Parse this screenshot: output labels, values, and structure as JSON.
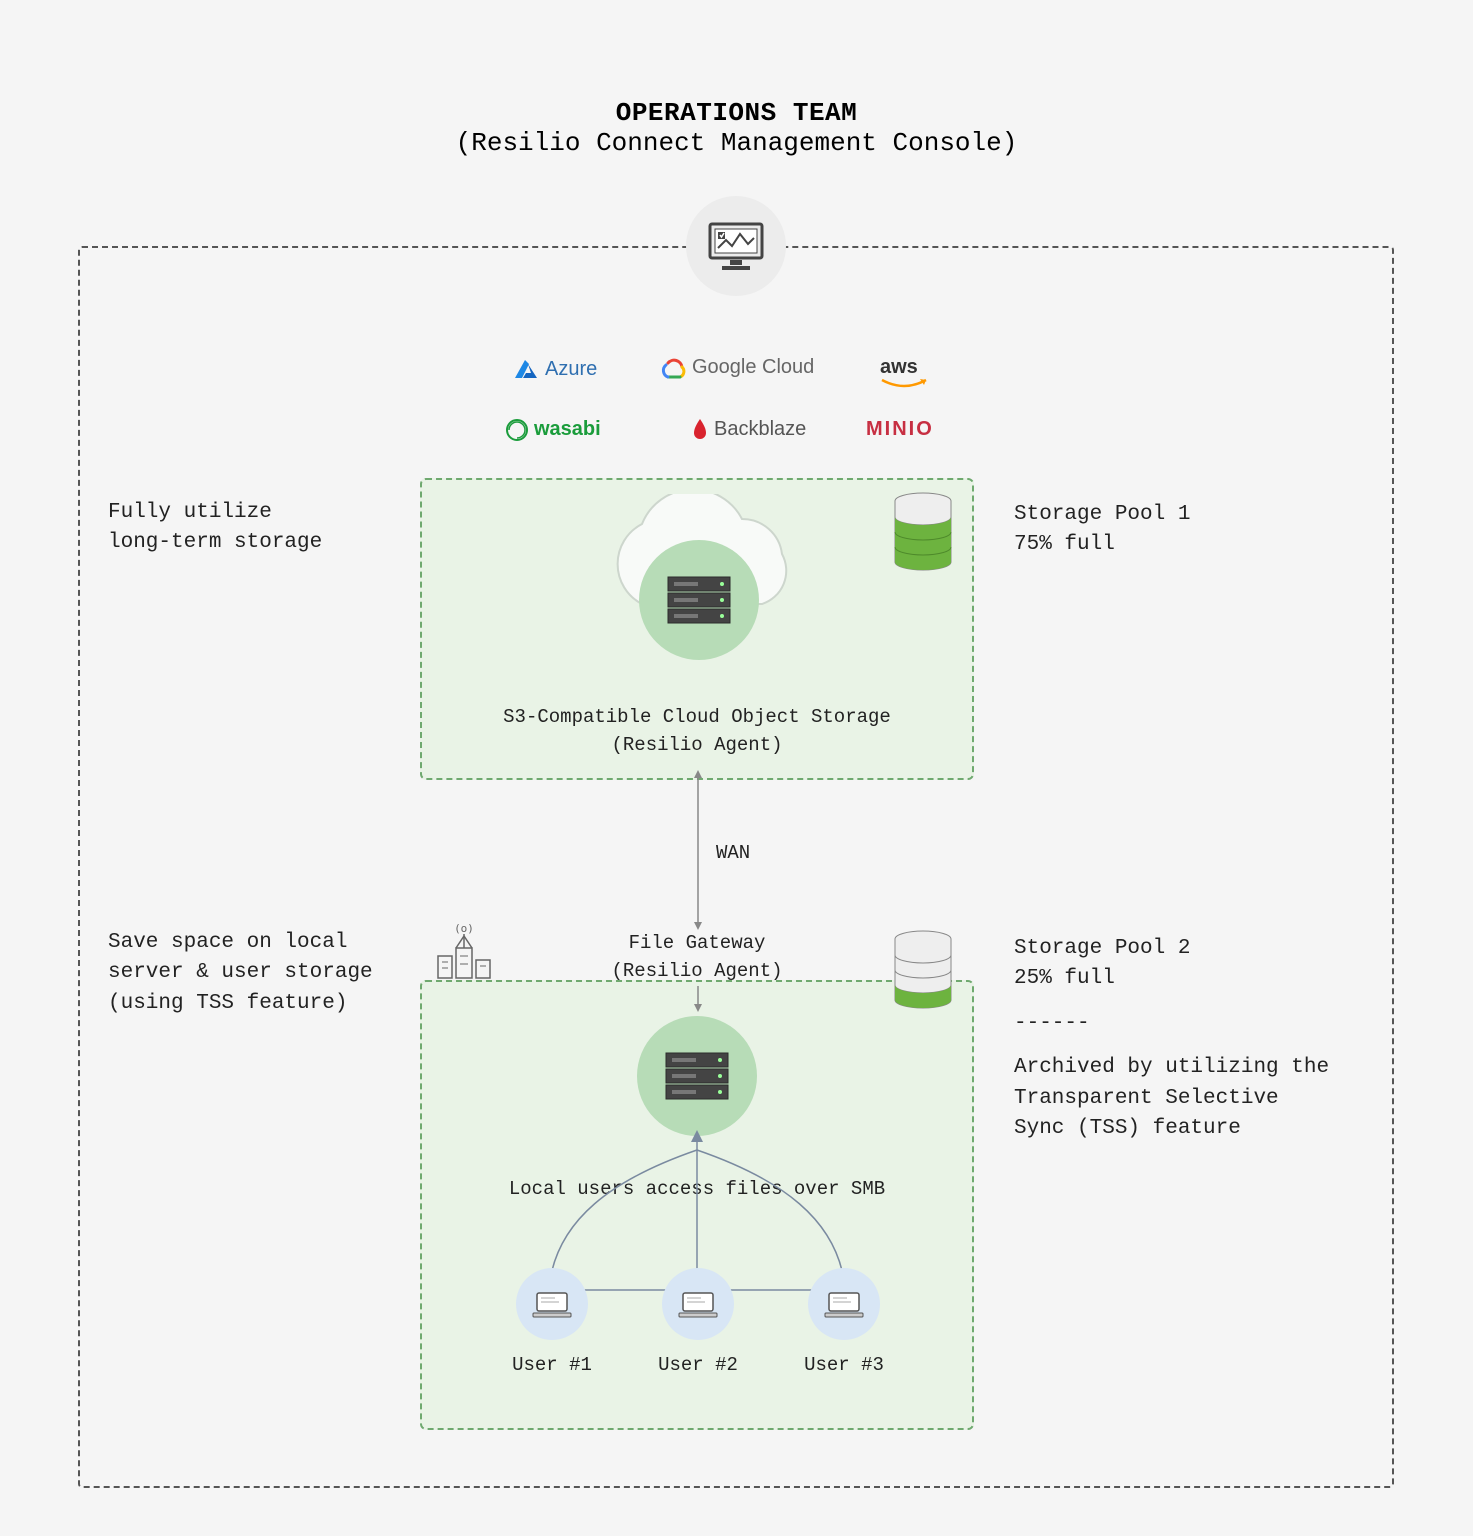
{
  "header": {
    "title": "OPERATIONS TEAM",
    "subtitle": "(Resilio Connect Management Console)"
  },
  "providers": {
    "azure": "Azure",
    "gcloud": "Google Cloud",
    "aws": "aws",
    "wasabi": "wasabi",
    "backblaze": "Backblaze",
    "minio": "MINIO"
  },
  "left_labels": {
    "top": "Fully utilize\nlong-term storage",
    "bottom": "Save space on local\nserver & user storage\n(using TSS feature)"
  },
  "boxes": {
    "cloud": {
      "caption_l1": "S3-Compatible Cloud Object Storage",
      "caption_l2": "(Resilio Agent)"
    },
    "gateway": {
      "caption_l1": "File Gateway",
      "caption_l2": "(Resilio Agent)"
    }
  },
  "connectors": {
    "wan": "WAN",
    "smb": "Local users access files over SMB"
  },
  "pools": {
    "pool1": {
      "name": "Storage Pool 1",
      "fill_text": "75% full",
      "fill_pct": 75
    },
    "pool2": {
      "name": "Storage Pool 2",
      "fill_text": "25% full",
      "fill_pct": 25,
      "divider": "------",
      "note": "Archived by utilizing the\nTransparent Selective\nSync (TSS) feature"
    }
  },
  "users": {
    "u1": "User #1",
    "u2": "User #2",
    "u3": "User #3"
  },
  "icons": {
    "monitor": "monitor-icon",
    "server": "server-icon",
    "city": "city-antenna-icon",
    "laptop": "laptop-icon",
    "db": "database-icon"
  }
}
